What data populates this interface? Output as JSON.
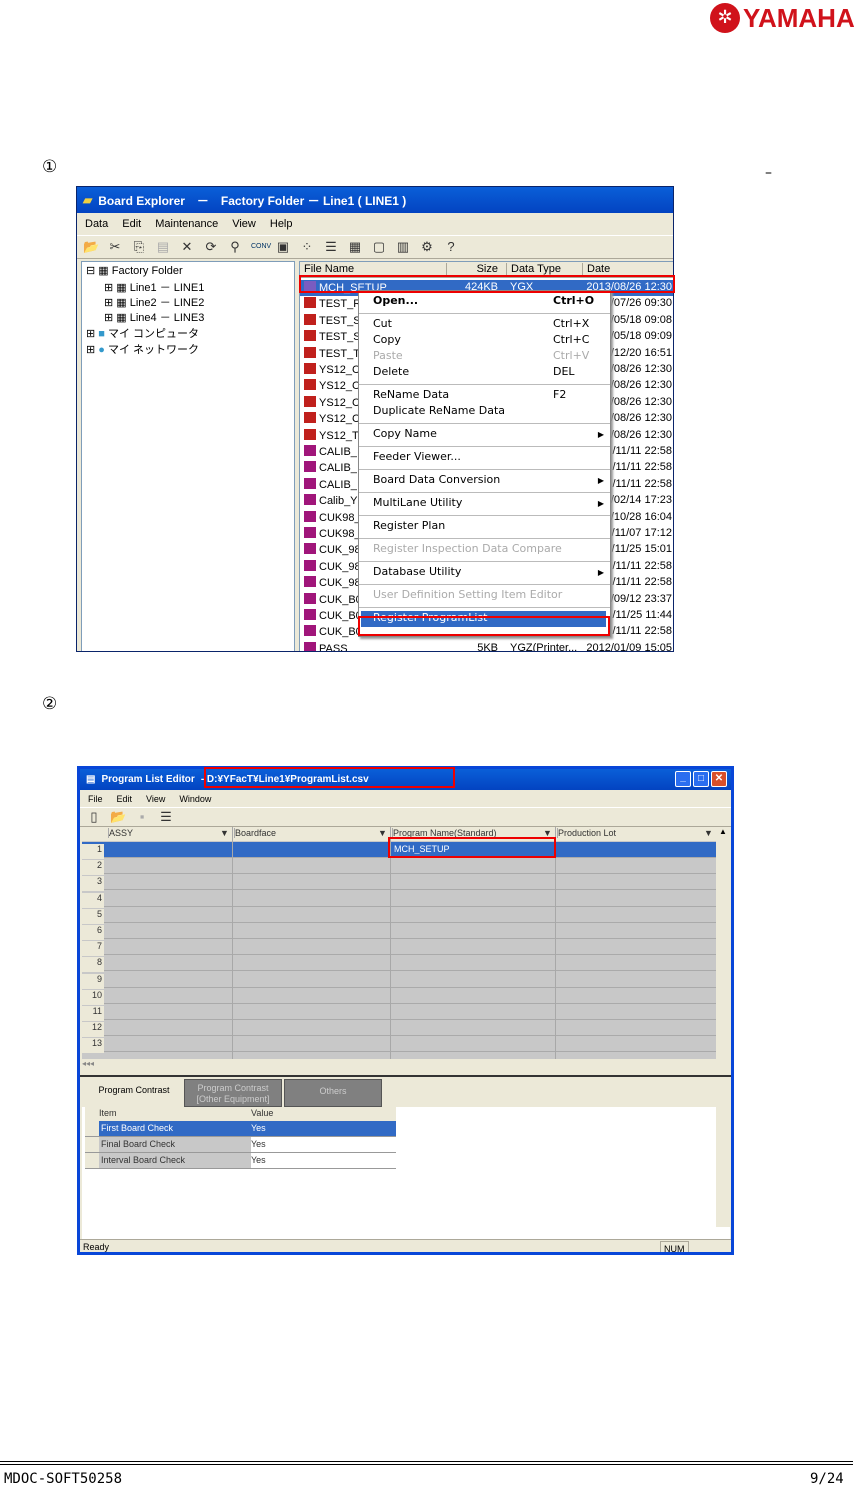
{
  "brand": {
    "logo_text": "YAMAHA"
  },
  "steps": [
    "①",
    "②"
  ],
  "dash": "–",
  "explorer": {
    "title": "Board Explorer　－　Factory Folder － Line1 ( LINE1 )",
    "menu": [
      "Data",
      "Edit",
      "Maintenance",
      "View",
      "Help"
    ],
    "tree": [
      {
        "label": "Factory Folder"
      },
      {
        "label": "Line1 － LINE1"
      },
      {
        "label": "Line2 － LINE2"
      },
      {
        "label": "Line4 － LINE3"
      },
      {
        "label": "マイ コンピュータ"
      },
      {
        "label": "マイ ネットワーク"
      }
    ],
    "columns": [
      "File Name",
      "Size",
      "Data Type",
      "Date"
    ],
    "files": [
      {
        "name": "MCH_SETUP",
        "size": "424KB",
        "type": "YGX",
        "date": "2013/08/26 12:30",
        "icon": "blu"
      },
      {
        "name": "TEST_R",
        "date": "/07/26 09:30",
        "icon": "red"
      },
      {
        "name": "TEST_S",
        "date": "/05/18 09:08",
        "icon": "red"
      },
      {
        "name": "TEST_S",
        "date": "/05/18 09:09",
        "icon": "red"
      },
      {
        "name": "TEST_T",
        "date": "/12/20 16:51",
        "icon": "red"
      },
      {
        "name": "YS12_C",
        "date": "/08/26 12:30",
        "icon": "red"
      },
      {
        "name": "YS12_C",
        "date": "/08/26 12:30",
        "icon": "red"
      },
      {
        "name": "YS12_C",
        "date": "/08/26 12:30",
        "icon": "red"
      },
      {
        "name": "YS12_C",
        "date": "/08/26 12:30",
        "icon": "red"
      },
      {
        "name": "YS12_T",
        "date": "/08/26 12:30",
        "icon": "red"
      },
      {
        "name": "CALIB_",
        "date": "/11/11 22:58",
        "icon": "pur"
      },
      {
        "name": "CALIB_",
        "date": "/11/11 22:58",
        "icon": "pur"
      },
      {
        "name": "CALIB_",
        "date": "/11/11 22:58",
        "icon": "pur"
      },
      {
        "name": "Calib_Y",
        "date": "/02/14 17:23",
        "icon": "pur"
      },
      {
        "name": "CUK98_",
        "date": "/10/28 16:04",
        "icon": "pur"
      },
      {
        "name": "CUK98_",
        "date": "/11/07 17:12",
        "icon": "pur"
      },
      {
        "name": "CUK_98",
        "date": "/11/25 15:01",
        "icon": "pur"
      },
      {
        "name": "CUK_98",
        "date": "/11/11 22:58",
        "icon": "pur"
      },
      {
        "name": "CUK_98",
        "date": "/11/11 22:58",
        "icon": "pur"
      },
      {
        "name": "CUK_B0",
        "date": "/09/12 23:37",
        "icon": "pur"
      },
      {
        "name": "CUK_B0",
        "date": "/11/25 11:44",
        "icon": "pur"
      },
      {
        "name": "CUK_B0",
        "date": "/11/11 22:58",
        "icon": "pur"
      },
      {
        "name": "PASS",
        "size": "5KB",
        "type": "YGZ(Printer...",
        "date": "2012/01/09 15:05",
        "icon": "pur"
      }
    ],
    "context_menu": [
      {
        "label": "Open...",
        "key": "Ctrl+O",
        "bold": true
      },
      {
        "sep": true
      },
      {
        "label": "Cut",
        "key": "Ctrl+X"
      },
      {
        "label": "Copy",
        "key": "Ctrl+C"
      },
      {
        "label": "Paste",
        "key": "Ctrl+V",
        "disabled": true
      },
      {
        "label": "Delete",
        "key": "DEL"
      },
      {
        "sep": true
      },
      {
        "label": "ReName Data",
        "key": "F2"
      },
      {
        "label": "Duplicate ReName Data"
      },
      {
        "sep": true
      },
      {
        "label": "Copy Name",
        "sub": true
      },
      {
        "sep": true
      },
      {
        "label": "Feeder Viewer..."
      },
      {
        "sep": true
      },
      {
        "label": "Board Data Conversion",
        "sub": true
      },
      {
        "sep": true
      },
      {
        "label": "MultiLane Utility",
        "sub": true
      },
      {
        "sep": true
      },
      {
        "label": "Register Plan"
      },
      {
        "sep": true
      },
      {
        "label": "Register Inspection Data Compare",
        "disabled": true
      },
      {
        "sep": true
      },
      {
        "label": "Database Utility",
        "sub": true
      },
      {
        "sep": true
      },
      {
        "label": "User Definition Setting Item Editor",
        "disabled": true
      },
      {
        "sep": true
      },
      {
        "label": "Register ProgramList",
        "selected": true
      }
    ]
  },
  "editor": {
    "title": "Program List Editor",
    "path": "- D:¥YFacT¥Line1¥ProgramList.csv",
    "menu": [
      "File",
      "Edit",
      "View",
      "Window"
    ],
    "columns": [
      "ASSY",
      "Boardface",
      "Program Name(Standard)",
      "Production Lot"
    ],
    "rows": [
      "1",
      "2",
      "3",
      "4",
      "5",
      "6",
      "7",
      "8",
      "9",
      "10",
      "11",
      "12",
      "13"
    ],
    "row1_program": "MCH_SETUP",
    "tabs": [
      "Program Contrast",
      "Program Contrast\n[Other Equipment]",
      "Others"
    ],
    "settings_header": [
      "Item",
      "Value"
    ],
    "settings": [
      {
        "item": "First Board Check",
        "value": "Yes"
      },
      {
        "item": "Final Board Check",
        "value": "Yes"
      },
      {
        "item": "Interval Board Check",
        "value": "Yes"
      }
    ],
    "status": "Ready",
    "num": "NUM"
  },
  "footer": {
    "doc_id": "MDOC-SOFT50258",
    "page": "9/24"
  }
}
